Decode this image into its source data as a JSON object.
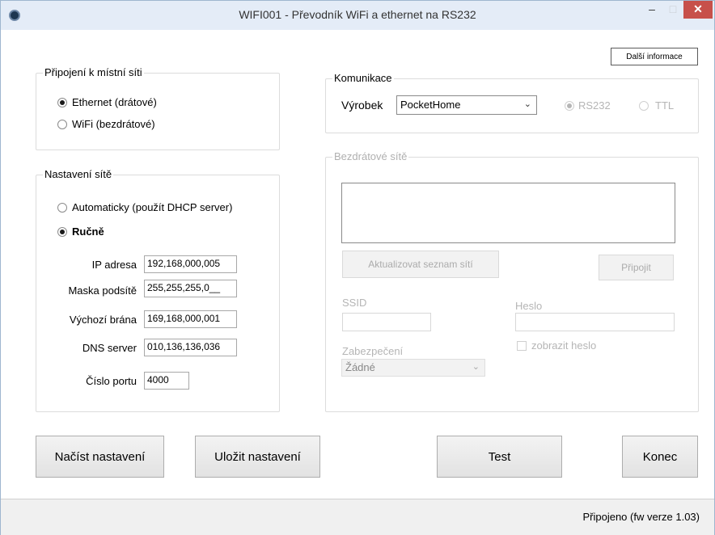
{
  "window": {
    "title": "WIFI001 - Převodník WiFi a ethernet na RS232",
    "minimize": "–",
    "maximize": "□",
    "close": "✕"
  },
  "more_info_button": "Další informace",
  "local_net": {
    "legend": "Připojení k místní síti",
    "options": [
      "Ethernet (drátové)",
      "WiFi (bezdrátové)"
    ],
    "selected": 0
  },
  "net_settings": {
    "legend": "Nastavení sítě",
    "modes": [
      "Automaticky (použít DHCP server)",
      "Ručně"
    ],
    "selected": 1,
    "fields": {
      "ip": {
        "label": "IP adresa",
        "value": "192,168,000,005"
      },
      "mask": {
        "label": "Maska podsítě",
        "value": "255,255,255,0__"
      },
      "gateway": {
        "label": "Výchozí brána",
        "value": "169,168,000,001"
      },
      "dns": {
        "label": "DNS server",
        "value": "010,136,136,036"
      },
      "port": {
        "label": "Číslo portu",
        "value": "4000"
      }
    }
  },
  "communication": {
    "legend": "Komunikace",
    "product_label": "Výrobek",
    "product_value": "PocketHome",
    "protocols": [
      "RS232",
      "TTL"
    ],
    "selected": 0
  },
  "wireless": {
    "legend": "Bezdrátové sítě",
    "refresh_button": "Aktualizovat seznam sítí",
    "connect_button": "Připojit",
    "ssid_label": "SSID",
    "ssid_value": "",
    "password_label": "Heslo",
    "password_value": "",
    "security_label": "Zabezpečení",
    "security_value": "Žádné",
    "show_password_label": "zobrazit heslo"
  },
  "buttons": {
    "load": "Načíst nastavení",
    "save": "Uložit nastavení",
    "test": "Test",
    "exit": "Konec"
  },
  "status": "Připojeno (fw verze 1.03)"
}
